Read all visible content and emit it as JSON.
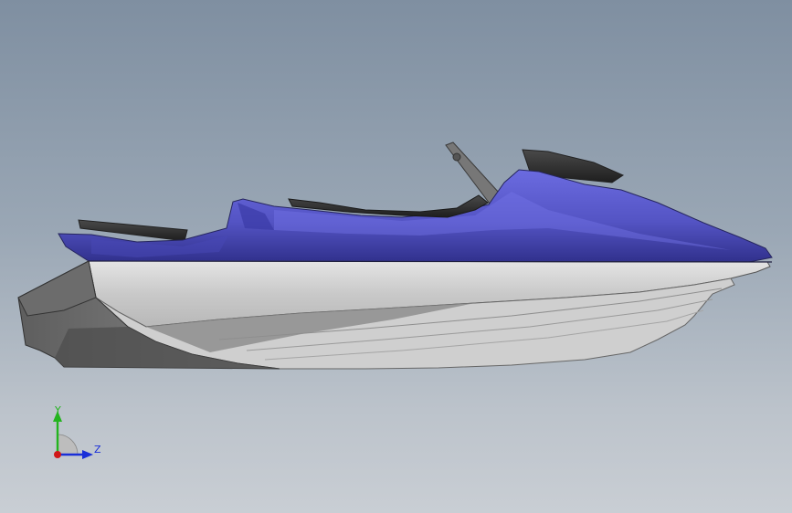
{
  "viewport": {
    "background_top": "#7f8fa1",
    "background_bottom": "#c9ced4"
  },
  "model": {
    "deck_color": "#5a5ad0",
    "hull_color": "#d2d2d2",
    "seat_color": "#3a3a3a",
    "handlebar_color": "#707070"
  },
  "triad": {
    "y_label": "Y",
    "z_label": "Z",
    "y_color": "#23b41e",
    "z_color": "#1a2fd8",
    "x_color": "#d01818"
  }
}
